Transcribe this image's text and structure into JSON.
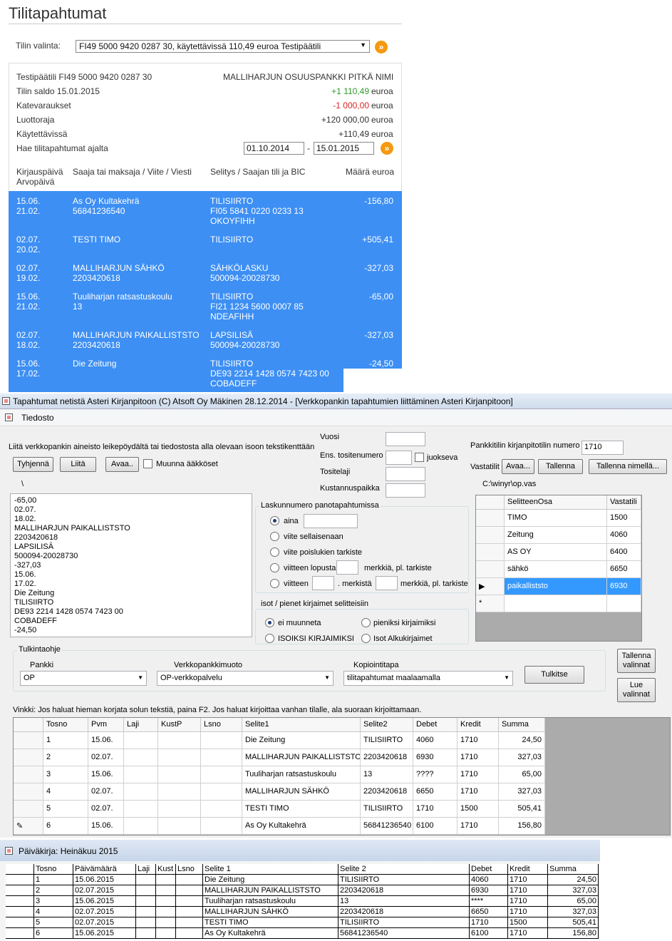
{
  "web": {
    "title": "Tilitapahtumat",
    "account_label": "Tilin valinta:",
    "account_value": "FI49 5000 9420 0287 30, käytettävissä 110,49 euroa Testipäätili",
    "go_icon": "»",
    "account_line": "Testipäätili FI49 5000 9420 0287 30",
    "bank_name": "MALLIHARJUN OSUUSPANKKI PITKÄ NIMI",
    "rows": [
      {
        "label": "Tilin saldo 15.01.2015",
        "value": "+1 110,49",
        "unit": "euroa"
      },
      {
        "label": "Katevaraukset",
        "value": "-1 000,00",
        "unit": "euroa"
      },
      {
        "label": "Luottoraja",
        "value": "+120 000,00",
        "unit": "euroa"
      },
      {
        "label": "Käytettävissä",
        "value": "+110,49",
        "unit": "euroa"
      }
    ],
    "period_label": "Hae tilitapahtumat ajalta",
    "date_from": "01.10.2014",
    "date_sep": "-",
    "date_to": "15.01.2015",
    "headers": {
      "date1": "Kirjauspäivä",
      "date2": "Arvopäivä",
      "payee": "Saaja tai maksaja / Viite / Viesti",
      "desc": "Selitys / Saajan tili ja BIC",
      "amount": "Määrä euroa"
    },
    "transactions": [
      {
        "d1": "15.06.",
        "d2": "21.02.",
        "p1": "As Oy Kultakehrä",
        "p2": "56841236540",
        "s1": "TILISIIRTO",
        "s2": "FI05 5841 0220 0233 13",
        "s3": "OKOYFIHH",
        "amount": "-156,80"
      },
      {
        "d1": "02.07.",
        "d2": "20.02.",
        "p1": "TESTI TIMO",
        "p2": "",
        "s1": "TILISIIRTO",
        "s2": "",
        "s3": "",
        "amount": "+505,41"
      },
      {
        "d1": "02.07.",
        "d2": "19.02.",
        "p1": "MALLIHARJUN SÄHKÖ",
        "p2": "2203420618",
        "s1": "SÄHKÖLASKU",
        "s2": "500094-20028730",
        "s3": "",
        "amount": "-327,03"
      },
      {
        "d1": "15.06.",
        "d2": "21.02.",
        "p1": "Tuuliharjan ratsastuskoulu",
        "p2": "13",
        "s1": "TILISIIRTO",
        "s2": "FI21 1234 5600 0007 85",
        "s3": "NDEAFIHH",
        "amount": "-65,00"
      },
      {
        "d1": "02.07.",
        "d2": "18.02.",
        "p1": "MALLIHARJUN PAIKALLISTSTO",
        "p2": "2203420618",
        "s1": "LAPSILISÄ",
        "s2": "500094-20028730",
        "s3": "",
        "amount": "-327,03"
      },
      {
        "d1": "15.06.",
        "d2": "17.02.",
        "p1": "Die Zeitung",
        "p2": "",
        "s1": "TILISIIRTO",
        "s2": "DE93 2214 1428 0574 7423 00",
        "s3": "COBADEFF",
        "amount": "-24,50"
      }
    ]
  },
  "app": {
    "title": "Tapahtumat netistä Asteri Kirjanpitoon    (C) Atsoft Oy Mäkinen 28.12.2014 - [Verkkopankin tapahtumien liittäminen Asteri Kirjanpitoon]",
    "menu_file": "Tiedosto",
    "paste_instruction": "Liitä verkkopankin aineisto leikepöydältä tai tiedostosta alla olevaan isoon tekstikenttään",
    "btn_clear": "Tyhjennä",
    "btn_paste": "Liitä",
    "btn_open": "Avaa..",
    "chk_convert": "Muunna ääkköset",
    "path_small": "\\",
    "paste_lines": [
      "-65,00",
      "02.07.",
      "18.02.",
      "MALLIHARJUN PAIKALLISTSTO",
      "2203420618",
      "LAPSILISÄ",
      "500094-20028730",
      "-327,03",
      "15.06.",
      "17.02.",
      "Die Zeitung",
      "TILISIIRTO",
      "DE93 2214 1428 0574 7423 00",
      "COBADEFF",
      "-24,50"
    ],
    "year_label": "Vuosi",
    "first_voucher_label": "Ens. tositenumero",
    "running_label": "juokseva",
    "voucher_type_label": "Tositelaji",
    "cost_center_label": "Kustannuspaikka",
    "account_number_label": "Pankkitilin kirjanpitotilin numero",
    "account_number": "1710",
    "counter_label": "Vastatilit",
    "btn_open2": "Avaa...",
    "btn_save": "Tallenna",
    "btn_save_as": "Tallenna nimellä...",
    "counter_path": "C:\\winyr\\op.vas",
    "invoice_group": "Laskunnumero panotapahtumissa",
    "radio_always": "aina",
    "radio_ref": "viite sellaisenaan",
    "radio_ref_nocheck": "viite poislukien tarkiste",
    "radio_ref_end": "viitteen lopusta",
    "chars_nocheck": "merkkiä, pl. tarkiste",
    "radio_ref_mid": "viitteen",
    "chars_mid": ". merkistä",
    "chars_mid2": "merkkiä, pl. tarkiste",
    "case_group": "isot / pienet kirjaimet selitteisiin",
    "radio_nochange": "ei muunneta",
    "radio_lower": "pieniksi kirjaimiksi",
    "radio_upper": "ISOIKSI KIRJAIMIKSI",
    "radio_capital": "Isot Alkukirjaimet",
    "counter_table": {
      "headers": [
        "SelitteenOsa",
        "Vastatili"
      ],
      "rows": [
        [
          "TIMO",
          "1500"
        ],
        [
          "Zeitung",
          "4060"
        ],
        [
          "AS OY",
          "6400"
        ],
        [
          "sähkö",
          "6650"
        ],
        [
          "paikalliststo",
          "6930"
        ]
      ],
      "new_row_marker": "*",
      "current_marker": "▶"
    },
    "interp_group": "Tulkintaohje",
    "bank_label": "Pankki",
    "bank_value": "OP",
    "format_label": "Verkkopankkimuoto",
    "format_value": "OP-verkkopalvelu",
    "copy_label": "Kopiointitapa",
    "copy_value": "tilitapahtumat maalaamalla",
    "btn_interpret": "Tulkitse",
    "btn_save_sel_1": "Tallenna",
    "btn_save_sel_2": "valinnat",
    "btn_load_sel_1": "Lue",
    "btn_load_sel_2": "valinnat",
    "hint": "Vinkki: Jos haluat hieman korjata solun tekstiä, paina F2. Jos haluat kirjoittaa vanhan tilalle, ala suoraan kirjoittamaan.",
    "result_table": {
      "headers": [
        "Tosno",
        "Pvm",
        "Laji",
        "KustP",
        "Lsno",
        "Selite1",
        "Selite2",
        "Debet",
        "Kredit",
        "Summa"
      ],
      "rows": [
        [
          "1",
          "15.06.",
          "",
          "",
          "",
          "Die Zeitung",
          "TILISIIRTO",
          "4060",
          "1710",
          "24,50"
        ],
        [
          "2",
          "02.07.",
          "",
          "",
          "",
          "MALLIHARJUN PAIKALLISTSTO",
          "2203420618",
          "6930",
          "1710",
          "327,03"
        ],
        [
          "3",
          "15.06.",
          "",
          "",
          "",
          "Tuuliharjan ratsastuskoulu",
          "13",
          "????",
          "1710",
          "65,00"
        ],
        [
          "4",
          "02.07.",
          "",
          "",
          "",
          "MALLIHARJUN SÄHKÖ",
          "2203420618",
          "6650",
          "1710",
          "327,03"
        ],
        [
          "5",
          "02.07.",
          "",
          "",
          "",
          "TESTI TIMO",
          "TILISIIRTO",
          "1710",
          "1500",
          "505,41"
        ],
        [
          "6",
          "15.06.",
          "",
          "",
          "",
          "As Oy Kultakehrä",
          "56841236540",
          "6100",
          "1710",
          "156,80"
        ]
      ]
    }
  },
  "journal": {
    "title": "Päiväkirja: Heinäkuu 2015",
    "headers": [
      "Tosno",
      "Päivämäärä",
      "Laji",
      "Kust",
      "Lsno",
      "Selite 1",
      "Selite 2",
      "Debet",
      "Kredit",
      "Summa"
    ],
    "rows": [
      [
        "1",
        "15.06.2015",
        "",
        "",
        "",
        "Die Zeitung",
        "TILISIIRTO",
        "4060",
        "1710",
        "24,50"
      ],
      [
        "2",
        "02.07.2015",
        "",
        "",
        "",
        "MALLIHARJUN PAIKALLISTSTO",
        "2203420618",
        "6930",
        "1710",
        "327,03"
      ],
      [
        "3",
        "15.06.2015",
        "",
        "",
        "",
        "Tuuliharjan ratsastuskoulu",
        "13",
        "****",
        "1710",
        "65,00"
      ],
      [
        "4",
        "02.07.2015",
        "",
        "",
        "",
        "MALLIHARJUN SÄHKÖ",
        "2203420618",
        "6650",
        "1710",
        "327,03"
      ],
      [
        "5",
        "02.07.2015",
        "",
        "",
        "",
        "TESTI TIMO",
        "TILISIIRTO",
        "1710",
        "1500",
        "505,41"
      ],
      [
        "6",
        "15.06.2015",
        "",
        "",
        "",
        "As Oy Kultakehrä",
        "56841236540",
        "6100",
        "1710",
        "156,80"
      ]
    ]
  }
}
